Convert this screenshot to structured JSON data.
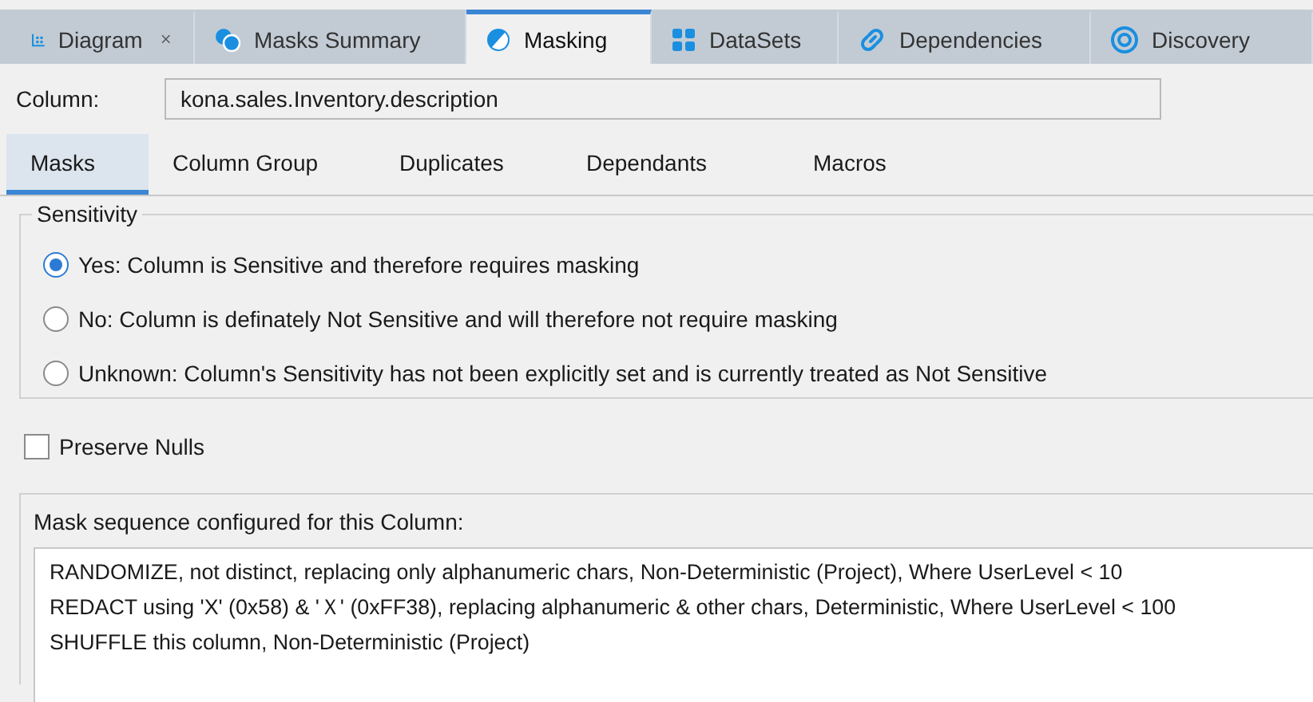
{
  "tabs": [
    {
      "label": "Diagram",
      "kind": "chart",
      "closable": true,
      "selected": false
    },
    {
      "label": "Masks Summary",
      "kind": "masks",
      "closable": false,
      "selected": false
    },
    {
      "label": "Masking",
      "kind": "mask",
      "closable": false,
      "selected": true
    },
    {
      "label": "DataSets",
      "kind": "grid",
      "closable": false,
      "selected": false
    },
    {
      "label": "Dependencies",
      "kind": "link",
      "closable": false,
      "selected": false
    },
    {
      "label": "Discovery",
      "kind": "target",
      "closable": false,
      "selected": false
    }
  ],
  "column": {
    "label": "Column:",
    "value": "kona.sales.Inventory.description"
  },
  "subtabs": [
    {
      "label": "Masks",
      "selected": true
    },
    {
      "label": "Column Group",
      "selected": false
    },
    {
      "label": "Duplicates",
      "selected": false
    },
    {
      "label": "Dependants",
      "selected": false
    },
    {
      "label": "Macros",
      "selected": false
    }
  ],
  "sensitivity": {
    "title": "Sensitivity",
    "options": [
      {
        "label": "Yes: Column is Sensitive and therefore requires masking",
        "selected": true
      },
      {
        "label": "No: Column is definately Not Sensitive and will therefore not require masking",
        "selected": false
      },
      {
        "label": "Unknown: Column's Sensitivity has not been explicitly set and is currently treated as Not Sensitive",
        "selected": false
      }
    ]
  },
  "preserve_nulls": {
    "label": "Preserve Nulls",
    "checked": false
  },
  "mask_sequence": {
    "title": "Mask sequence configured for this Column:",
    "items": [
      "RANDOMIZE, not distinct, replacing only alphanumeric chars, Non-Deterministic (Project), Where UserLevel < 10",
      "REDACT using 'X' (0x58) & 'Ｘ' (0xFF38), replacing alphanumeric & other chars, Deterministic, Where UserLevel < 100",
      "SHUFFLE this column, Non-Deterministic (Project)"
    ]
  }
}
